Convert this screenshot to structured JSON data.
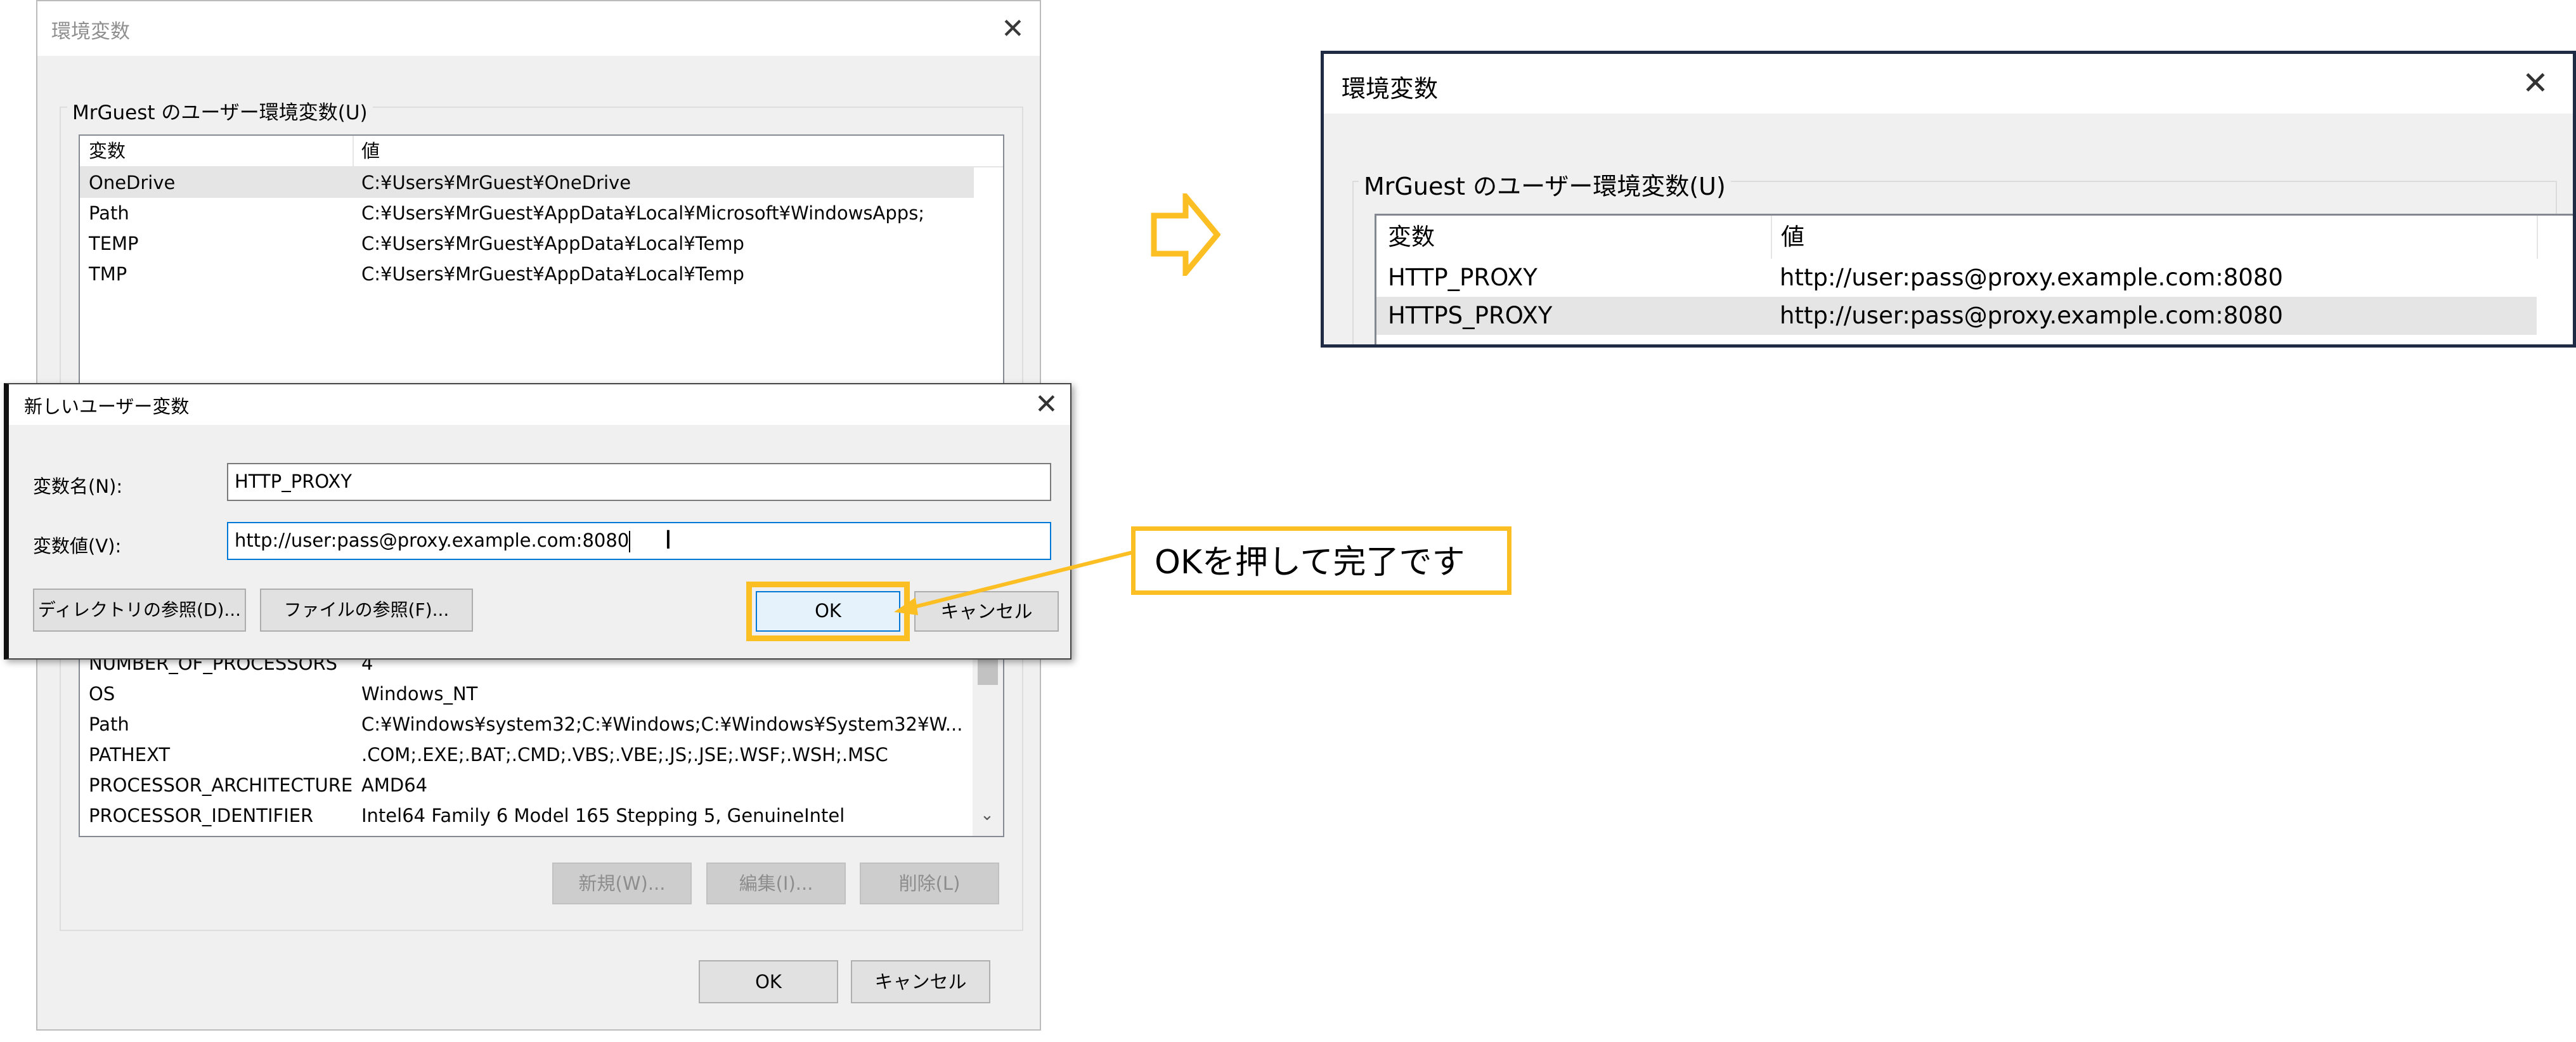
{
  "bg_dialog": {
    "title": "環境変数",
    "user_section_label": "MrGuest のユーザー環境変数(U)",
    "user_columns": [
      "変数",
      "値"
    ],
    "user_rows": [
      {
        "name": "OneDrive",
        "value": "C:¥Users¥MrGuest¥OneDrive"
      },
      {
        "name": "Path",
        "value": "C:¥Users¥MrGuest¥AppData¥Local¥Microsoft¥WindowsApps;"
      },
      {
        "name": "TEMP",
        "value": "C:¥Users¥MrGuest¥AppData¥Local¥Temp"
      },
      {
        "name": "TMP",
        "value": "C:¥Users¥MrGuest¥AppData¥Local¥Temp"
      }
    ],
    "system_rows": [
      {
        "name": "NUMBER_OF_PROCESSORS",
        "value": "4"
      },
      {
        "name": "OS",
        "value": "Windows_NT"
      },
      {
        "name": "Path",
        "value": "C:¥Windows¥system32;C:¥Windows;C:¥Windows¥System32¥W..."
      },
      {
        "name": "PATHEXT",
        "value": ".COM;.EXE;.BAT;.CMD;.VBS;.VBE;.JS;.JSE;.WSF;.WSH;.MSC"
      },
      {
        "name": "PROCESSOR_ARCHITECTURE",
        "value": "AMD64"
      },
      {
        "name": "PROCESSOR_IDENTIFIER",
        "value": "Intel64 Family 6 Model 165 Stepping 5, GenuineIntel"
      }
    ],
    "buttons": {
      "new": "新規(W)...",
      "edit": "編集(I)...",
      "delete": "削除(L)",
      "ok": "OK",
      "cancel": "キャンセル"
    }
  },
  "new_var_dialog": {
    "title": "新しいユーザー変数",
    "name_label": "変数名(N):",
    "name_value": "HTTP_PROXY",
    "value_label": "変数値(V):",
    "value_value": "http://user:pass@proxy.example.com:8080",
    "browse_dir": "ディレクトリの参照(D)...",
    "browse_file": "ファイルの参照(F)...",
    "ok": "OK",
    "cancel": "キャンセル"
  },
  "callout": {
    "text": "OKを押して完了です",
    "color": "#fbbf24"
  },
  "result_dialog": {
    "title": "環境変数",
    "section_label": "MrGuest のユーザー環境変数(U)",
    "columns": [
      "変数",
      "値"
    ],
    "rows": [
      {
        "name": "HTTP_PROXY",
        "value": "http://user:pass@proxy.example.com:8080"
      },
      {
        "name": "HTTPS_PROXY",
        "value": "http://user:pass@proxy.example.com:8080"
      }
    ]
  },
  "arrow_icon": "right-arrow-icon",
  "accent_color": "#fbbf24"
}
